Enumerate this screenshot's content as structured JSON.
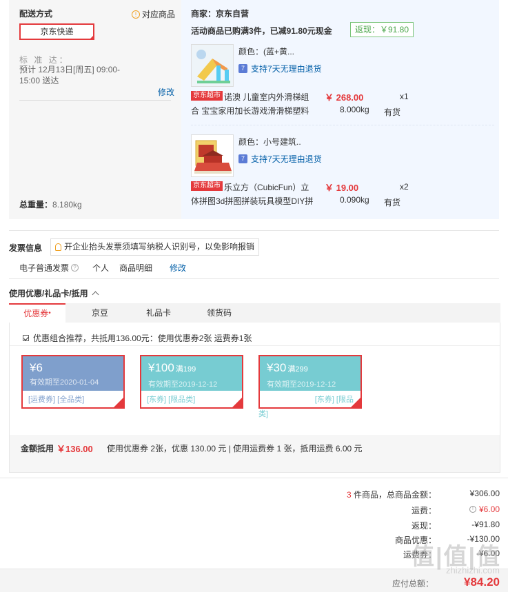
{
  "shipping": {
    "title": "配送方式",
    "match_goods": "对应商品",
    "method": "京东快递",
    "standard_label": "标 准 达：",
    "eta": "预计 12月13日[周五] 09:00-15:00 送达",
    "edit": "修改",
    "total_weight_label": "总重量：",
    "total_weight": "8.180kg"
  },
  "order": {
    "merchant": "商家：京东自营",
    "promo": "活动商品已购满3件，已减91.80元现金",
    "rebate_badge": "返现：￥91.80",
    "items": [
      {
        "color": "颜色：(蓝+黄...",
        "return_policy": "支持7天无理由退货",
        "tag": "京东超市",
        "name": "诺澳 儿童室内外滑梯组合 宝宝家用加长游戏滑滑梯塑料",
        "price": "￥ 268.00",
        "qty": "x1",
        "weight": "8.000kg",
        "stock": "有货"
      },
      {
        "color": "颜色：小号建筑..",
        "return_policy": "支持7天无理由退货",
        "tag": "京东超市",
        "name": "乐立方（CubicFun）立体拼图3d拼图拼装玩具模型DIY拼",
        "price": "￥ 19.00",
        "qty": "x2",
        "weight": "0.090kg",
        "stock": "有货"
      }
    ]
  },
  "invoice": {
    "title": "发票信息",
    "tip": "开企业抬头发票须填写纳税人识别号，以免影响报销",
    "type": "电子普通发票",
    "personal": "个人",
    "detail": "商品明细",
    "edit": "修改"
  },
  "coupons": {
    "title": "使用优惠/礼品卡/抵用",
    "tabs": [
      {
        "label": "优惠券",
        "active": true,
        "dot": "•"
      },
      {
        "label": "京豆",
        "active": false
      },
      {
        "label": "礼品卡",
        "active": false
      },
      {
        "label": "领货码",
        "active": false
      }
    ],
    "combo_text": "优惠组合推荐，共抵用136.00元：使用优惠券2张 运费券1张",
    "list": [
      {
        "amount": "¥6",
        "threshold": "",
        "valid": "有效期至2020-01-04",
        "cats": "[运费券]  [全品类]"
      },
      {
        "amount": "¥100",
        "threshold": "满199",
        "valid": "有效期至2019-12-12",
        "cats": "[东券]  [限品类]"
      },
      {
        "amount": "¥30",
        "threshold": "满299",
        "valid": "有效期至2019-12-12",
        "cats": "[东券]  [限品",
        "cats_overflow": "类]"
      }
    ],
    "deduct_label": "金额抵用",
    "deduct_amount": "￥136.00",
    "deduct_desc": "使用优惠券 2张，优惠 130.00 元 | 使用运费券 1 张，抵用运费 6.00 元"
  },
  "summary": {
    "count": "3",
    "count_suffix": " 件商品，总商品金额：",
    "goods_total": "¥306.00",
    "shipping_label": "运费：",
    "shipping_value": "¥6.00",
    "rebate_label": "返现：",
    "rebate_value": "-¥91.80",
    "coupon_label": "商品优惠：",
    "coupon_value": "-¥130.00",
    "freight_coupon_label": "运费券：",
    "freight_coupon_value": "-¥6.00",
    "payable_label": "应付总额：",
    "payable_value": "¥84.20"
  },
  "watermark": {
    "brand": "值|值|值",
    "url": "zhizhizhi.com"
  },
  "colors": {
    "accent_red": "#e4393c",
    "link_blue": "#005ea7",
    "rebate_green": "#4aa54a",
    "coupon_freight": "#7f9fcc",
    "coupon_east": "#77ccd2"
  }
}
